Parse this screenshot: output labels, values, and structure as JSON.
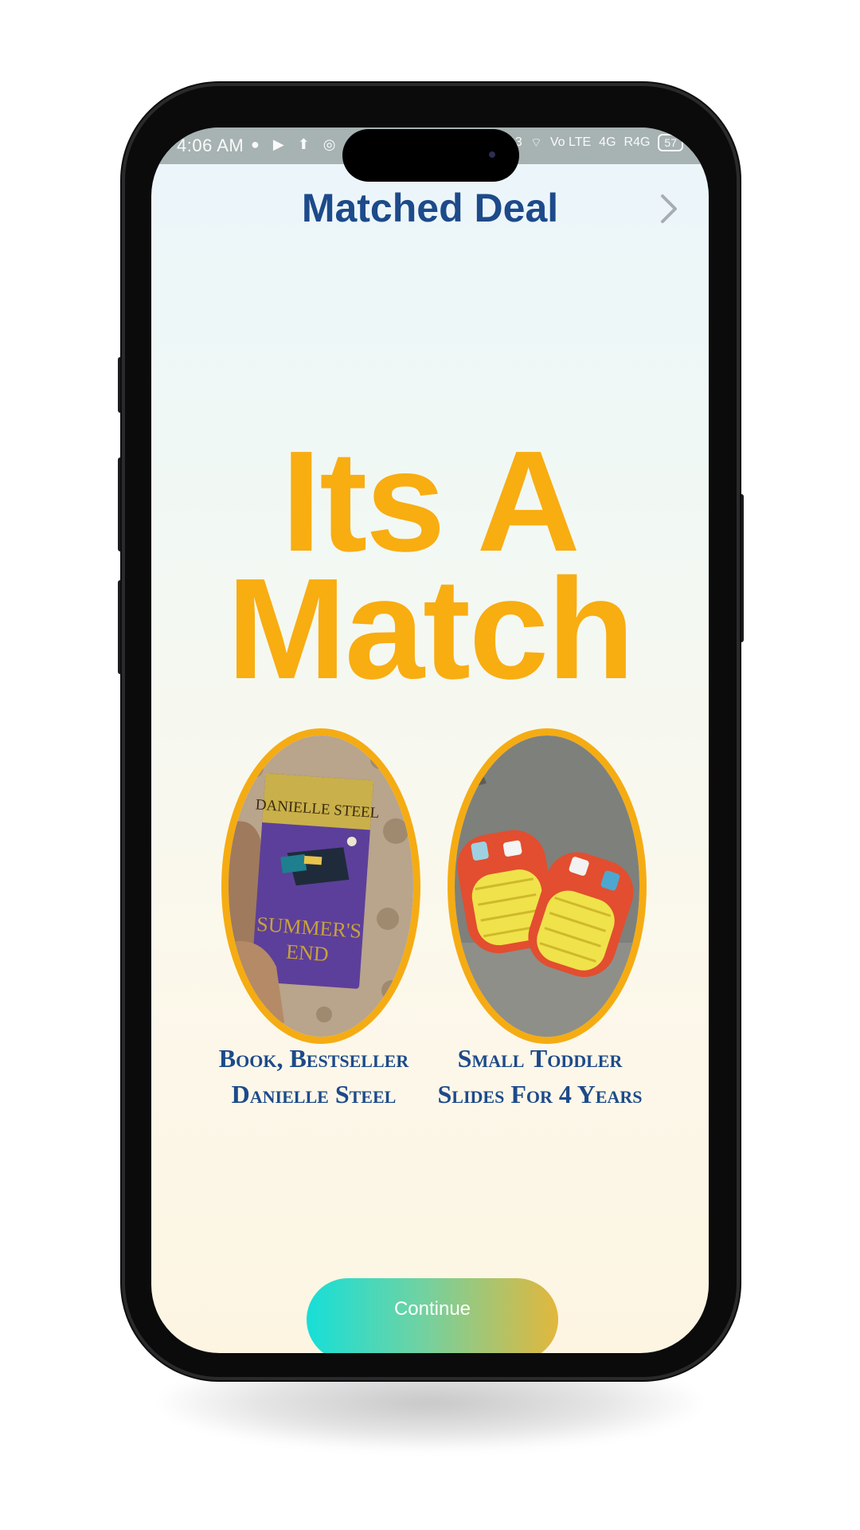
{
  "status_bar": {
    "time": "4:06 AM",
    "left_icons": "● ▶ ⬆ ◎",
    "right_icons": [
      "1.13",
      "⌔",
      "Vo LTE",
      "4G",
      "R4G"
    ],
    "battery": "57"
  },
  "header": {
    "title": "Matched Deal"
  },
  "match": {
    "line1": "Its A",
    "line2": "Match"
  },
  "items": [
    {
      "label": "Book, Bestseller Danielle Steel",
      "image_text_author": "DANIELLE STEEL",
      "image_text_title_1": "SUMMER'S",
      "image_text_title_2": "END"
    },
    {
      "label": "Small Toddler Slides For 4 Years"
    }
  ],
  "actions": {
    "continue_label": "Continue"
  },
  "colors": {
    "title": "#1d4a8a",
    "accent": "#f8ad11",
    "button_start": "#16dfd8",
    "button_end": "#e2b73c"
  }
}
